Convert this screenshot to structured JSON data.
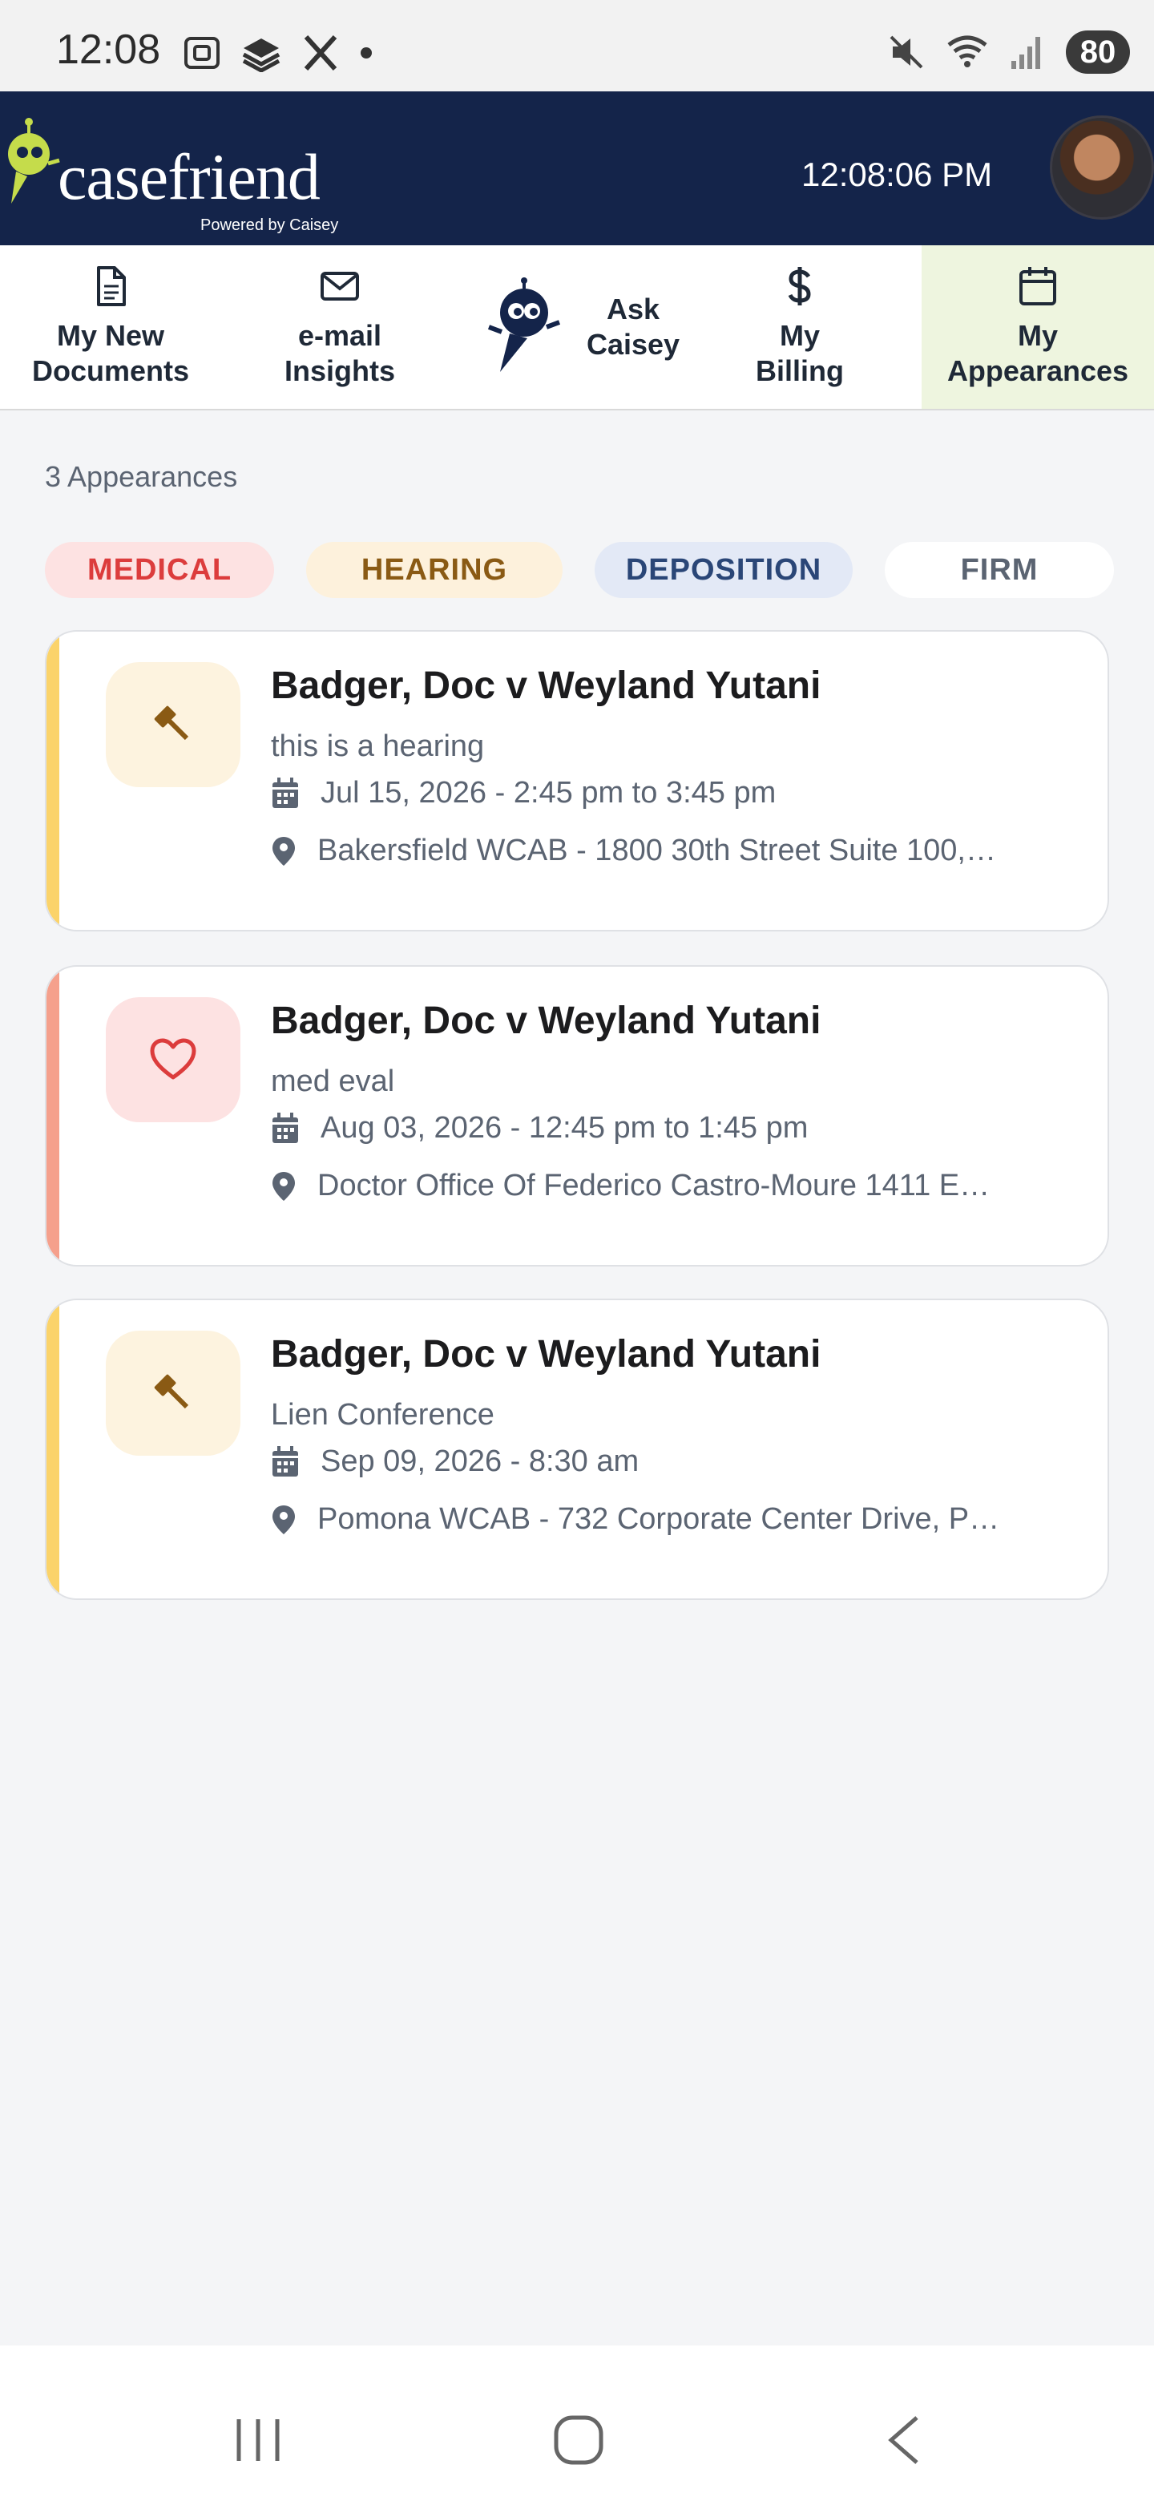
{
  "status_bar": {
    "time": "12:08",
    "battery": "80"
  },
  "header": {
    "brand": "casefriend",
    "powered_by": "Powered by Caisey",
    "clock": "12:08:06 PM"
  },
  "nav": {
    "tabs": [
      {
        "line1": "My New",
        "line2": "Documents",
        "icon": "document-icon"
      },
      {
        "line1": "e-mail",
        "line2": "Insights",
        "icon": "mail-icon"
      },
      {
        "line1": "Ask",
        "line2": "Caisey",
        "icon": "robot-icon"
      },
      {
        "line1": "My",
        "line2": "Billing",
        "icon": "dollar-icon"
      },
      {
        "line1": "My",
        "line2": "Appearances",
        "icon": "calendar-icon",
        "active": true
      }
    ]
  },
  "appearances": {
    "count_label": "3 Appearances",
    "filters": [
      "MEDICAL",
      "HEARING",
      "DEPOSITION",
      "FIRM"
    ],
    "items": [
      {
        "type": "hearing",
        "icon": "gavel-icon",
        "title": "Badger, Doc v Weyland Yutani",
        "subtitle": "this is a hearing",
        "datetime": "Jul 15, 2026 - 2:45 pm to 3:45 pm",
        "location": "Bakersfield WCAB - 1800 30th Street Suite 100,…"
      },
      {
        "type": "medical",
        "icon": "heart-icon",
        "title": "Badger, Doc v Weyland Yutani",
        "subtitle": "med eval",
        "datetime": "Aug 03, 2026 - 12:45 pm to 1:45 pm",
        "location": "Doctor Office Of Federico Castro-Moure 1411 E…"
      },
      {
        "type": "hearing",
        "icon": "gavel-icon",
        "title": "Badger, Doc v Weyland Yutani",
        "subtitle": "Lien Conference",
        "datetime": "Sep 09, 2026 - 8:30 am",
        "location": "Pomona WCAB - 732 Corporate Center Drive, P…"
      }
    ]
  },
  "colors": {
    "header_bg": "#14244a",
    "brand_accent": "#c5dc4b",
    "active_tab_bg": "#eef5df",
    "hearing_accent": "#fbd36a",
    "medical_accent": "#f5a08c"
  }
}
